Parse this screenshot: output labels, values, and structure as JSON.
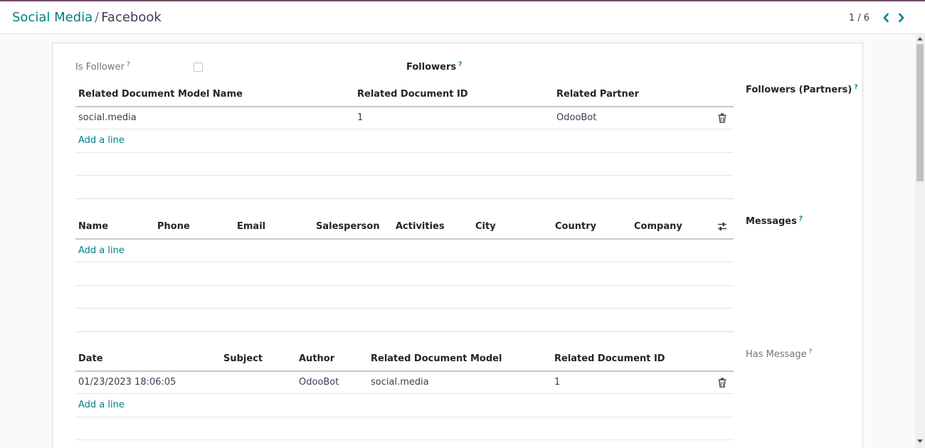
{
  "breadcrumb": {
    "parent": "Social Media",
    "separator": "/",
    "current": "Facebook"
  },
  "pager": {
    "value": "1 / 6"
  },
  "fields": {
    "is_follower": "Is Follower",
    "followers": "Followers",
    "followers_partners": "Followers (Partners)",
    "messages": "Messages",
    "has_message": "Has Message",
    "help_mark": "?"
  },
  "followers_table": {
    "headers": [
      "Related Document Model Name",
      "Related Document ID",
      "Related Partner"
    ],
    "rows": [
      {
        "model": "social.media",
        "doc_id": "1",
        "partner": "OdooBot"
      }
    ],
    "add_line": "Add a line"
  },
  "partners_table": {
    "headers": [
      "Name",
      "Phone",
      "Email",
      "Salesperson",
      "Activities",
      "City",
      "Country",
      "Company"
    ],
    "add_line": "Add a line"
  },
  "messages_table": {
    "headers": [
      "Date",
      "Subject",
      "Author",
      "Related Document Model",
      "Related Document ID"
    ],
    "rows": [
      {
        "date": "01/23/2023 18:06:05",
        "subject": "",
        "author": "OdooBot",
        "model": "social.media",
        "doc_id": "1"
      }
    ],
    "add_line": "Add a line"
  },
  "icons": {
    "prev": "chevron-left-icon",
    "next": "chevron-right-icon",
    "delete": "trash-icon",
    "optional_columns": "sliders-icon"
  },
  "colors": {
    "accent": "#017e84",
    "brand": "#714b67"
  }
}
